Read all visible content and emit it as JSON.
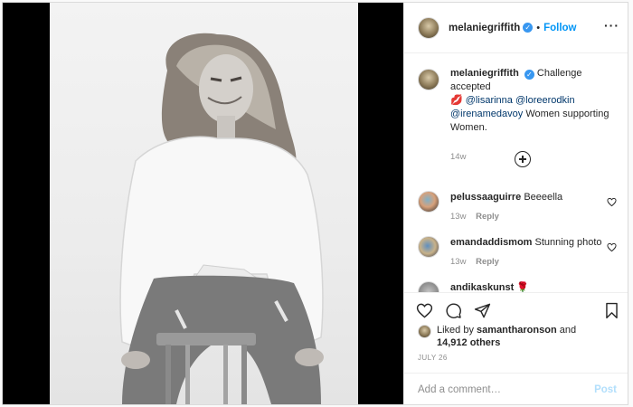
{
  "post": {
    "username": "melaniegriffith",
    "follow_label": "Follow",
    "more_icon": "more-dots-icon",
    "caption": {
      "text_before": "Challenge accepted",
      "emoji": "💋",
      "mentions": [
        "@lisarinna",
        "@loreerodkin",
        "@irenamedavoy"
      ],
      "text_after": "Women supporting Women.",
      "time": "14w"
    },
    "comments": [
      {
        "username": "pelussaaguirre",
        "text": "Beeeella",
        "time": "13w",
        "reply_label": "Reply"
      },
      {
        "username": "emandaddismom",
        "text": "Stunning photo",
        "time": "13w",
        "reply_label": "Reply"
      },
      {
        "username": "andikaskunst",
        "text": "🌹",
        "time": "",
        "reply_label": ""
      }
    ],
    "likes": {
      "prefix": "Liked by",
      "user": "samantharonson",
      "and": "and",
      "others": "14,912 others"
    },
    "date": "JULY 26",
    "add_comment_placeholder": "Add a comment…",
    "post_label": "Post"
  },
  "colors": {
    "accent": "#0095f6",
    "verified": "#3897f0",
    "post_disabled": "#b2dffc",
    "muted": "#8e8e8e"
  }
}
